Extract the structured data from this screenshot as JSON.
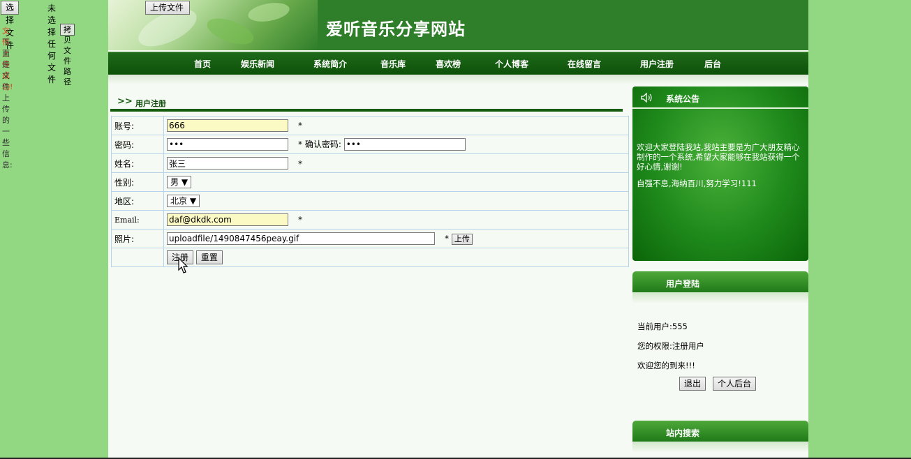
{
  "upload": {
    "choose_file": "选择文件",
    "no_file": "未选择任何文件",
    "upload_btn": "上传文件",
    "success": "文件上传成功!",
    "copy_path": "拷贝文件路径",
    "info": "下面是文件上传的一些信息:"
  },
  "header": {
    "title": "爱听音乐分享网站"
  },
  "nav": {
    "items": [
      {
        "label": "首页"
      },
      {
        "label": "娱乐新闻"
      },
      {
        "label": "系统简介"
      },
      {
        "label": "音乐库"
      },
      {
        "label": "喜欢榜"
      },
      {
        "label": "个人博客"
      },
      {
        "label": "在线留言"
      },
      {
        "label": "用户注册"
      },
      {
        "label": "后台"
      }
    ]
  },
  "section": {
    "chevron": ">>",
    "title": "用户注册"
  },
  "form": {
    "account_label": "账号:",
    "account_value": "666",
    "password_label": "密码:",
    "password_value": "•••",
    "confirm_label": "* 确认密码:",
    "confirm_value": "•••",
    "name_label": "姓名:",
    "name_value": "张三",
    "gender_label": "性别:",
    "gender_value": "男",
    "region_label": "地区:",
    "region_value": "北京",
    "email_label": "Email:",
    "email_value": "daf@dkdk.com",
    "photo_label": "照片:",
    "photo_value": "uploadfile/1490847456peay.gif",
    "upload_label": "上传",
    "submit_label": "注册",
    "reset_label": "重置",
    "required": "*"
  },
  "notice": {
    "title": "系统公告",
    "text1": "欢迎大家登陆我站,我站主要是为广大朋友精心制作的一个系统,希望大家能够在我站获得一个好心情,谢谢!",
    "text2": "自强不息,海纳百川,努力学习!111"
  },
  "login": {
    "title": "用户登陆",
    "current_user": "当前用户:555",
    "role": "您的权限:注册用户",
    "welcome": "欢迎您的到来!!!",
    "logout": "退出",
    "personal": "个人后台"
  },
  "search": {
    "title": "站内搜索"
  },
  "colors": {
    "header": "#2f7e2a",
    "nav": "#0d5109",
    "background": "#92d883",
    "panel": "#1f8a1c"
  }
}
